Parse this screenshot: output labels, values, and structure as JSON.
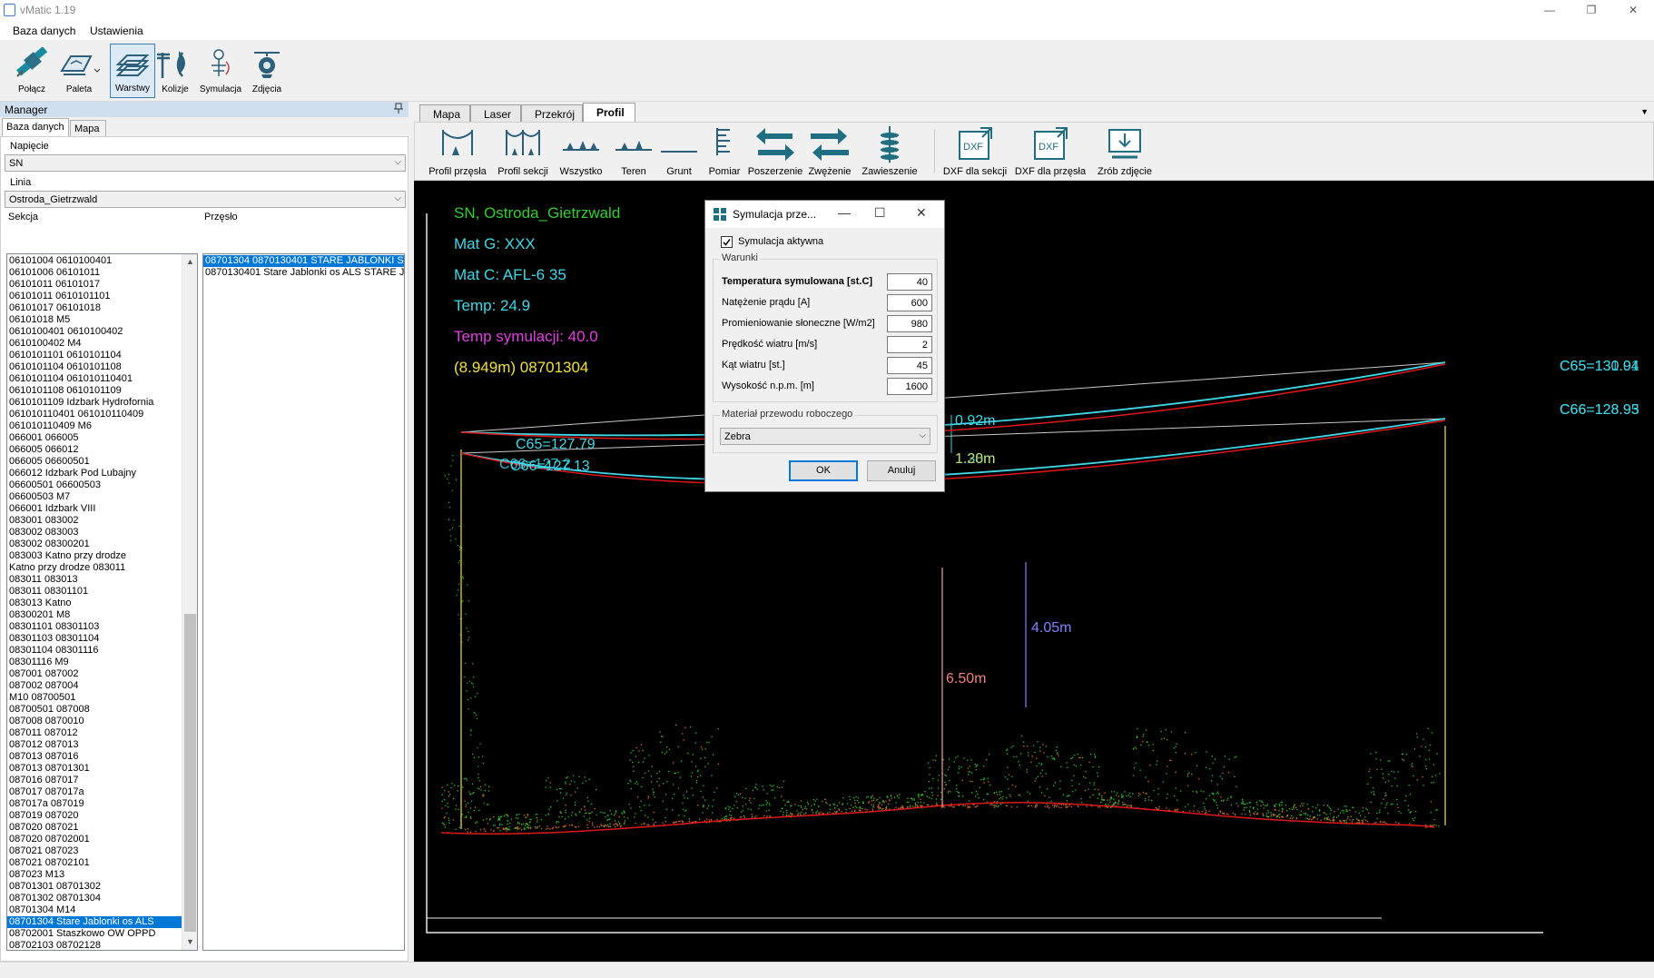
{
  "window": {
    "title": "vMatic 1.19",
    "minimize": "—",
    "restore": "❐",
    "close": "✕"
  },
  "menu": {
    "items": [
      "Baza danych",
      "Ustawienia"
    ]
  },
  "toolbar": {
    "buttons": [
      {
        "label": "Połącz",
        "icon": "satellite-icon"
      },
      {
        "label": "Paleta",
        "icon": "palette-icon"
      },
      {
        "label": "Warstwy",
        "icon": "layers-icon"
      },
      {
        "label": "Kolizje",
        "icon": "collision-icon"
      },
      {
        "label": "Symulacja",
        "icon": "simulation-icon"
      },
      {
        "label": "Zdjęcia",
        "icon": "camera-drone-icon"
      }
    ]
  },
  "manager": {
    "title": "Manager",
    "pin": "📌",
    "tabs": [
      "Baza danych",
      "Mapa"
    ],
    "napiecie_label": "Napięcie",
    "napiecie_value": "SN",
    "linia_label": "Linia",
    "linia_value": "Ostroda_Gietrzwald",
    "sekcja_label": "Sekcja",
    "przeslo_label": "Przęsło",
    "sekcje": [
      "06101004 0610100401",
      "06101006 06101011",
      "06101011 06101017",
      "06101011 0610101101",
      "06101017 06101018",
      "06101018 M5",
      "0610100401 0610100402",
      "0610100402 M4",
      "0610101101 0610101104",
      "0610101104 0610101108",
      "0610101104 061010110401",
      "0610101108 0610101109",
      "0610101109 Idzbark Hydrofornia",
      "061010110401 061010110409",
      "061010110409 M6",
      "066001 066005",
      "066005 066012",
      "066005 06600501",
      "066012 Idzbark Pod Lubajny",
      "06600501 06600503",
      "06600503 M7",
      "066001 Idzbark VIII",
      "083001 083002",
      "083002 083003",
      "083002 08300201",
      "083003 Katno przy drodze",
      "Katno przy drodze 083011",
      "083011 083013",
      "083011 08301101",
      "083013 Katno",
      "08300201 M8",
      "08301101 08301103",
      "08301103 08301104",
      "08301104 08301116",
      "08301116 M9",
      "087001 087002",
      "087002 087004",
      "M10 08700501",
      "08700501 087008",
      "087008 0870010",
      "087011 087012",
      "087012 087013",
      "087013 087016",
      "087013 08701301",
      "087016 087017",
      "087017 087017a",
      "087017a 087019",
      "087019 087020",
      "087020 087021",
      "087020 08702001",
      "087021 087023",
      "087021 08702101",
      "087023 M13",
      "08701301 08701302",
      "08701302 08701304",
      "08701304 M14",
      "08701304 Stare Jablonki os ALS",
      "08702001 Staszkowo OW OPPD",
      "08702103 08702128"
    ],
    "sekcja_selected_index": 56,
    "przesla": [
      "08701304 0870130401 STARE JABLONKI S",
      "0870130401 Stare Jablonki os ALS STARE J"
    ],
    "przeslo_selected_index": 0
  },
  "doc_tabs": [
    "Mapa",
    "Laser",
    "Przekrój",
    "Profil"
  ],
  "doc_tab_selected": 3,
  "profil_toolbar": {
    "buttons": [
      {
        "label": "Profil przęsła",
        "icon": "span-profile-icon"
      },
      {
        "label": "Profil sekcji",
        "icon": "section-profile-icon"
      },
      {
        "label": "Wszystko",
        "icon": "all-icon"
      },
      {
        "label": "Teren",
        "icon": "terrain-icon"
      },
      {
        "label": "Grunt",
        "icon": "ground-icon"
      },
      {
        "label": "Pomiar",
        "icon": "ruler-icon"
      },
      {
        "label": "Poszerzenie",
        "icon": "widen-icon"
      },
      {
        "label": "Zwężenie",
        "icon": "narrow-icon"
      },
      {
        "label": "Zawieszenie",
        "icon": "insulator-icon"
      },
      {
        "label": "DXF dla sekcji",
        "icon": "dxf-section-icon"
      },
      {
        "label": "DXF dla przęsła",
        "icon": "dxf-span-icon"
      },
      {
        "label": "Zrób zdjęcie",
        "icon": "screenshot-icon"
      }
    ]
  },
  "profile": {
    "info": {
      "line": "SN, Ostroda_Gietrzwald",
      "mat_g": "Mat G: XXX",
      "mat_c": "Mat C: AFL-6 35",
      "temp": "Temp:  24.9",
      "temp_sym": "Temp symulacji:  40.0",
      "span": "(8.949m) 08701304"
    },
    "labels": {
      "c65_left": "C65=127.79",
      "c66_left": "C66=127.13",
      "c66_left_overlap": "C66=127.2",
      "c65_right": "C65=130.94",
      "c65_right_overlap": "C65=131.01",
      "c66_right": "C66=128.93",
      "c66_right_overlap": "C66=128.95",
      "d1": "0.92m",
      "d2": "1.30m",
      "d2_overlap": "1.28m",
      "h1": "6.50m",
      "h2": "4.05m"
    },
    "colors": {
      "cyan": "#3fd8e8",
      "red": "#e01818",
      "green": "#33cc33",
      "magenta": "#e040e0",
      "yellow": "#f0e040",
      "white_line": "#d0d0d0"
    }
  },
  "dialog": {
    "title": "Symulacja prze...",
    "min": "—",
    "max": "☐",
    "close": "✕",
    "active_label": "Symulacja aktywna",
    "active_checked": true,
    "conditions_legend": "Warunki",
    "fields": [
      {
        "label": "Temperatura symulowana [st.C]",
        "value": "40",
        "bold": true
      },
      {
        "label": "Natężenie prądu [A]",
        "value": "600"
      },
      {
        "label": "Promieniowanie słoneczne [W/m2]",
        "value": "980"
      },
      {
        "label": "Prędkość wiatru [m/s]",
        "value": "2"
      },
      {
        "label": "Kąt wiatru [st.]",
        "value": "45"
      },
      {
        "label": "Wysokość n.p.m. [m]",
        "value": "1600"
      }
    ],
    "material_legend": "Materiał przewodu roboczego",
    "material_value": "Zebra",
    "ok": "OK",
    "cancel": "Anuluj"
  }
}
